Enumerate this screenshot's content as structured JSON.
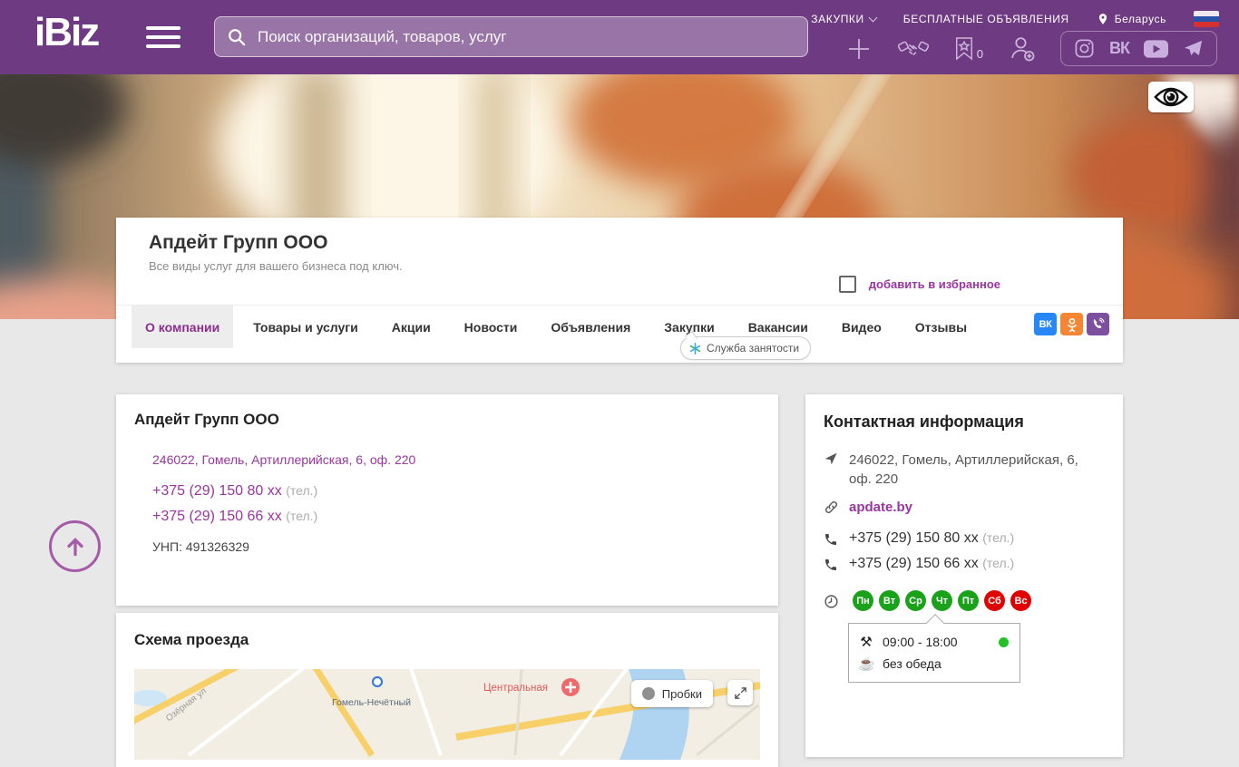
{
  "colors": {
    "header_purple": "#6e3a81",
    "accent_purple": "#9a35a0",
    "active_tab_purple": "#8b2f8f",
    "workday_green": "#1aa21a",
    "dayoff_red": "#e10000",
    "online_green": "#21c227",
    "vk_blue": "#2787f5",
    "ok_orange": "#f68634",
    "viber_purple": "#7d4f9e"
  },
  "header": {
    "logo_text": "iBiz",
    "search_placeholder": "Поиск организаций, товаров, услуг",
    "zakupki_label": "ЗАКУПКИ",
    "free_ads_label": "БЕСПЛАТНЫЕ ОБЪЯВЛЕНИЯ",
    "location_label": "Беларусь",
    "bookmarks_count": "0",
    "vk_label": "ВК"
  },
  "company": {
    "name": "Апдейт Групп ООО",
    "tagline": "Все виды услуг для вашего бизнеса под ключ.",
    "favorite_label": "добавить в избранное",
    "tabs": [
      {
        "label": "О компании",
        "active": true
      },
      {
        "label": "Товары и услуги",
        "active": false
      },
      {
        "label": "Акции",
        "active": false
      },
      {
        "label": "Новости",
        "active": false
      },
      {
        "label": "Объявления",
        "active": false
      },
      {
        "label": "Закупки",
        "active": false
      },
      {
        "label": "Вакансии",
        "active": false
      },
      {
        "label": "Видео",
        "active": false
      },
      {
        "label": "Отзывы",
        "active": false
      }
    ],
    "employment_badge": "Служба занятости",
    "social_vk": "ВК"
  },
  "info_card": {
    "title": "Апдейт Групп ООО",
    "address": "246022, Гомель, Артиллерийская, 6, оф. 220",
    "phones": [
      {
        "number": "+375 (29) 150 80 xx",
        "note": "(тел.)"
      },
      {
        "number": "+375 (29) 150 66 xx",
        "note": "(тел.)"
      }
    ],
    "unp": "УНП: 491326329"
  },
  "map_card": {
    "title": "Схема проезда",
    "traffic_button": "Пробки",
    "labels": {
      "lake_street": "Озёрная ул",
      "district": "Гомель-Нечётный",
      "central": "Центральная"
    }
  },
  "contact_card": {
    "title": "Контактная информация",
    "address": "246022, Гомель, Артиллерийская, 6, оф. 220",
    "website": "apdate.by",
    "phones": [
      {
        "number": "+375 (29) 150 80 xx",
        "note": "(тел.)"
      },
      {
        "number": "+375 (29) 150 66 xx",
        "note": "(тел.)"
      }
    ],
    "days": [
      {
        "label": "Пн",
        "status": "work"
      },
      {
        "label": "Вт",
        "status": "work"
      },
      {
        "label": "Ср",
        "status": "work"
      },
      {
        "label": "Чт",
        "status": "work"
      },
      {
        "label": "Пт",
        "status": "work"
      },
      {
        "label": "Сб",
        "status": "off"
      },
      {
        "label": "Вс",
        "status": "off"
      }
    ],
    "schedule": {
      "hours": "09:00 - 18:00",
      "lunch": "без обеда"
    }
  },
  "glyphs": {
    "tools": "⚒",
    "coffee": "☕"
  }
}
